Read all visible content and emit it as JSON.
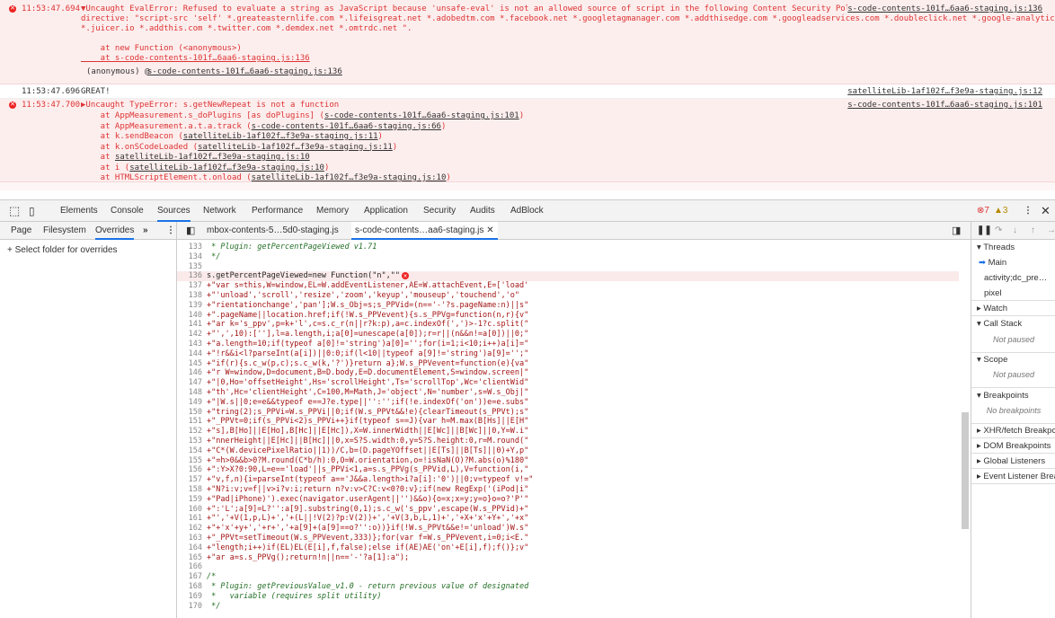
{
  "console": {
    "err1": {
      "time": "11:53:47.694",
      "lines": [
        "▼Uncaught EvalError: Refused to evaluate a string as JavaScript because 'unsafe-eval' is not an allowed source of script in the following Content Security Policy",
        "directive: \"script-src 'self' *.greateasternlife.com *.lifeisgreat.net *.adobedtm.com *.facebook.net *.googletagmanager.com *.addthisedge.com *.googleadservices.com *.doubleclick.net *.google-analytics.com",
        "*.juicer.io *.addthis.com *.twitter.com *.demdex.net *.omtrdc.net \".",
        "",
        "    at new Function (<anonymous>)",
        "    at s-code-contents-101f…6aa6-staging.js:136"
      ],
      "anon": "(anonymous) @ ",
      "anon_link": "s-code-contents-101f…6aa6-staging.js:136",
      "source": "s-code-contents-101f…6aa6-staging.js:136"
    },
    "log1": {
      "time": "11:53:47.696",
      "text": "GREAT!",
      "source": "satelliteLib-1af102f…f3e9a-staging.js:12"
    },
    "err2": {
      "time": "11:53:47.700",
      "head": "▶Uncaught TypeError: s.getNewRepeat is not a function",
      "source": "s-code-contents-101f…6aa6-staging.js:101",
      "stack": [
        {
          "pre": "    at AppMeasurement.s_doPlugins [as doPlugins] (",
          "link": "s-code-contents-101f…6aa6-staging.js:101",
          "post": ")"
        },
        {
          "pre": "    at AppMeasurement.a.t.a.track (",
          "link": "s-code-contents-101f…6aa6-staging.js:66",
          "post": ")"
        },
        {
          "pre": "    at k.sendBeacon (",
          "link": "satelliteLib-1af102f…f3e9a-staging.js:11",
          "post": ")"
        },
        {
          "pre": "    at k.onSCodeLoaded (",
          "link": "satelliteLib-1af102f…f3e9a-staging.js:11",
          "post": ")"
        },
        {
          "pre": "    at ",
          "link": "satelliteLib-1af102f…f3e9a-staging.js:10",
          "post": ""
        },
        {
          "pre": "    at i (",
          "link": "satelliteLib-1af102f…f3e9a-staging.js:10",
          "post": ")"
        },
        {
          "pre": "    at HTMLScriptElement.t.onload (",
          "link": "satelliteLib-1af102f…f3e9a-staging.js:10",
          "post": ")"
        }
      ]
    }
  },
  "tabs": [
    "Elements",
    "Console",
    "Sources",
    "Network",
    "Performance",
    "Memory",
    "Application",
    "Security",
    "Audits",
    "AdBlock"
  ],
  "active_tab": "Sources",
  "status": {
    "errors": "7",
    "warnings": "3"
  },
  "left_tabs": [
    "Page",
    "Filesystem",
    "Overrides"
  ],
  "select_folder": "+ Select folder for overrides",
  "files": [
    "mbox-contents-5…5d0-staging.js",
    "s-code-contents…aa6-staging.js"
  ],
  "code": [
    {
      "n": "133",
      "t": " * Plugin: getPercentPageViewed v1.71",
      "c": true
    },
    {
      "n": "134",
      "t": " */",
      "c": true
    },
    {
      "n": "135",
      "t": ""
    },
    {
      "n": "136",
      "t": "s.getPercentPageViewed=new Function(\"n\",\"\""
    },
    {
      "n": "137",
      "t": "+\"var s=this,W=window,EL=W.addEventListener,AE=W.attachEvent,E=['load'"
    },
    {
      "n": "138",
      "t": "+\"'unload','scroll','resize','zoom','keyup','mouseup','touchend','o\""
    },
    {
      "n": "139",
      "t": "+\"rientationchange','pan'];W.s_Obj=s;s_PPVid=(n=='-'?s.pageName:n)||s\""
    },
    {
      "n": "140",
      "t": "+\".pageName||location.href;if(!W.s_PPVevent){s.s_PPVg=function(n,r){v\""
    },
    {
      "n": "141",
      "t": "+\"ar k='s_ppv',p=k+'l',c=s.c_r(n||r?k:p),a=c.indexOf(',')>-1?c.split(\""
    },
    {
      "n": "142",
      "t": "+\"',',10):[''],l=a.length,i;a[0]=unescape(a[0]);r=r||(n&&n!=a[0])||0;\""
    },
    {
      "n": "143",
      "t": "+\"a.length=10;if(typeof a[0]!='string')a[0]='';for(i=1;i<10;i++)a[i]=\""
    },
    {
      "n": "144",
      "t": "+\"!r&&i<l?parseInt(a[i])||0:0;if(l<10||typeof a[9]!='string')a[9]='';\""
    },
    {
      "n": "145",
      "t": "+\"if(r){s.c_w(p,c);s.c_w(k,'?')}return a};W.s_PPVevent=function(e){va\""
    },
    {
      "n": "146",
      "t": "+\"r W=window,D=document,B=D.body,E=D.documentElement,S=window.screen|\""
    },
    {
      "n": "147",
      "t": "+\"|0,Ho='offsetHeight',Hs='scrollHeight',Ts='scrollTop',Wc='clientWid\""
    },
    {
      "n": "148",
      "t": "+\"th',Hc='clientHeight',C=100,M=Math,J='object',N='number',s=W.s_Obj|\""
    },
    {
      "n": "149",
      "t": "+\"|W.s||0;e=e&&typeof e==J?e.type||'':'';if(!e.indexOf('on'))e=e.subs\""
    },
    {
      "n": "150",
      "t": "+\"tring(2);s_PPVi=W.s_PPVi||0;if(W.s_PPVt&&!e){clearTimeout(s_PPVt);s\""
    },
    {
      "n": "151",
      "t": "+\"_PPVt=0;if(s_PPVi<2)s_PPVi++}if(typeof s==J){var h=M.max(B[Hs]||E[H\""
    },
    {
      "n": "152",
      "t": "+\"s],B[Ho]||E[Ho],B[Hc]||E[Hc]),X=W.innerWidth||E[Wc]||B[Wc]||0,Y=W.i\""
    },
    {
      "n": "153",
      "t": "+\"nnerHeight||E[Hc]||B[Hc]||0,x=S?S.width:0,y=S?S.height:0,r=M.round(\""
    },
    {
      "n": "154",
      "t": "+\"C*(W.devicePixelRatio||1))/C,b=(D.pageYOffset||E[Ts]||B[Ts]||0)+Y,p\""
    },
    {
      "n": "155",
      "t": "+\"=h>0&&b>0?M.round(C*b/h):0,O=W.orientation,o=!isNaN(O)?M.abs(o)%180\""
    },
    {
      "n": "156",
      "t": "+\":Y>X?0:90,L=e=='load'||s_PPVi<1,a=s.s_PPVg(s_PPVid,L),V=function(i,\""
    },
    {
      "n": "157",
      "t": "+\"v,f,n){i=parseInt(typeof a=='J&&a.length>i?a[i]:'0')||0;v=typeof v!=\""
    },
    {
      "n": "158",
      "t": "+\"N?i:v;v=f||v>i?v:i;return n?v:v>C?C:v<0?0:v};if(new RegExp('(iPod|i\""
    },
    {
      "n": "159",
      "t": "+\"Pad|iPhone)').exec(navigator.userAgent||'')&&o){o=x;x=y;y=o}o=o?'P'\""
    },
    {
      "n": "160",
      "t": "+\":'L';a[9]=L?'':a[9].substring(0,1);s.c_w('s_ppv',escape(W.s_PPVid)+\""
    },
    {
      "n": "161",
      "t": "+\"','+V(1,p,L)+','+(L||!V(2)?p:V(2))+','+V(3,b,L,1)+','+X+'x'+Y+','+x\""
    },
    {
      "n": "162",
      "t": "+\"+'x'+y+','+r+','+a[9]+(a[9]==o?'':o))}if(!W.s_PPVt&&e!='unload')W.s\""
    },
    {
      "n": "163",
      "t": "+\"_PPVt=setTimeout(W.s_PPVevent,333)};for(var f=W.s_PPVevent,i=0;i<E.\""
    },
    {
      "n": "164",
      "t": "+\"length;i++)if(EL)EL(E[i],f,false);else if(AE)AE('on'+E[i],f);f()};v\""
    },
    {
      "n": "165",
      "t": "+\"ar a=s.s_PPVg();return!n||n=='-'?a[1]:a\");"
    },
    {
      "n": "166",
      "t": ""
    },
    {
      "n": "167",
      "t": "/*",
      "c": true
    },
    {
      "n": "168",
      "t": " * Plugin: getPreviousValue_v1.0 - return previous value of designated",
      "c": true
    },
    {
      "n": "169",
      "t": " *   variable (requires split utility)",
      "c": true
    },
    {
      "n": "170",
      "t": " */",
      "c": true
    }
  ],
  "right": {
    "threads": "Threads",
    "thread_items": [
      "Main",
      "activity;dc_pre…",
      "pixel"
    ],
    "watch": "Watch",
    "call_stack": "Call Stack",
    "not_paused": "Not paused",
    "scope": "Scope",
    "breakpoints": "Breakpoints",
    "no_breakpoints": "No breakpoints",
    "xhr": "XHR/fetch Breakpoints",
    "dom": "DOM Breakpoints",
    "global": "Global Listeners",
    "event": "Event Listener Breakpoints"
  }
}
